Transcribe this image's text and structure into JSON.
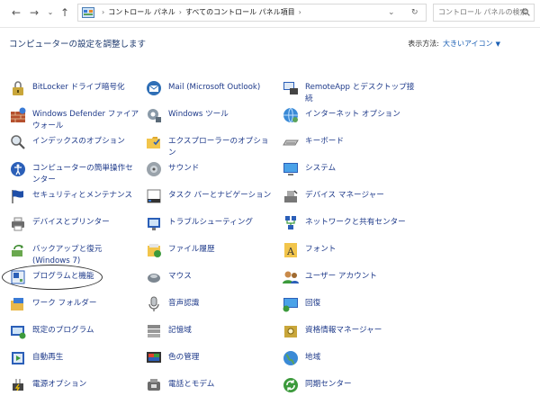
{
  "address": {
    "crumbs": [
      "コントロール パネル",
      "すべてのコントロール パネル項目"
    ],
    "search_placeholder": "コントロール パネルの検索"
  },
  "header": {
    "title": "コンピューターの設定を調整します",
    "view_by_label": "表示方法:",
    "view_by_value": "大きいアイコン"
  },
  "columns": [
    [
      {
        "label": "BitLocker ドライブ暗号化",
        "icon": "bitlocker-icon"
      },
      {
        "label": "Windows Defender ファイアウォール",
        "icon": "firewall-icon"
      },
      {
        "label": "インデックスのオプション",
        "icon": "indexing-icon"
      },
      {
        "label": "コンピューターの簡単操作センター",
        "icon": "ease-of-access-icon"
      },
      {
        "label": "セキュリティとメンテナンス",
        "icon": "security-flag-icon"
      },
      {
        "label": "デバイスとプリンター",
        "icon": "printer-icon"
      },
      {
        "label": "バックアップと復元 (Windows 7)",
        "icon": "backup-icon"
      },
      {
        "label": "プログラムと機能",
        "icon": "programs-icon"
      },
      {
        "label": "ワーク フォルダー",
        "icon": "work-folders-icon"
      },
      {
        "label": "既定のプログラム",
        "icon": "default-programs-icon"
      },
      {
        "label": "自動再生",
        "icon": "autoplay-icon"
      },
      {
        "label": "電源オプション",
        "icon": "power-icon"
      }
    ],
    [
      {
        "label": "Mail (Microsoft Outlook)",
        "icon": "mail-icon"
      },
      {
        "label": "Windows ツール",
        "icon": "windows-tools-icon"
      },
      {
        "label": "エクスプローラーのオプション",
        "icon": "folder-options-icon"
      },
      {
        "label": "サウンド",
        "icon": "sound-icon"
      },
      {
        "label": "タスク バーとナビゲーション",
        "icon": "taskbar-icon"
      },
      {
        "label": "トラブルシューティング",
        "icon": "troubleshoot-icon"
      },
      {
        "label": "ファイル履歴",
        "icon": "file-history-icon"
      },
      {
        "label": "マウス",
        "icon": "mouse-icon"
      },
      {
        "label": "音声認識",
        "icon": "microphone-icon"
      },
      {
        "label": "記憶域",
        "icon": "storage-icon"
      },
      {
        "label": "色の管理",
        "icon": "color-management-icon"
      },
      {
        "label": "電話とモデム",
        "icon": "phone-modem-icon"
      }
    ],
    [
      {
        "label": "RemoteApp とデスクトップ接続",
        "icon": "remoteapp-icon"
      },
      {
        "label": "インターネット オプション",
        "icon": "internet-options-icon"
      },
      {
        "label": "キーボード",
        "icon": "keyboard-icon"
      },
      {
        "label": "システム",
        "icon": "system-icon"
      },
      {
        "label": "デバイス マネージャー",
        "icon": "device-manager-icon"
      },
      {
        "label": "ネットワークと共有センター",
        "icon": "network-icon"
      },
      {
        "label": "フォント",
        "icon": "fonts-icon"
      },
      {
        "label": "ユーザー アカウント",
        "icon": "user-accounts-icon"
      },
      {
        "label": "回復",
        "icon": "recovery-icon"
      },
      {
        "label": "資格情報マネージャー",
        "icon": "credential-icon"
      },
      {
        "label": "地域",
        "icon": "region-icon"
      },
      {
        "label": "同期センター",
        "icon": "sync-icon"
      }
    ]
  ]
}
